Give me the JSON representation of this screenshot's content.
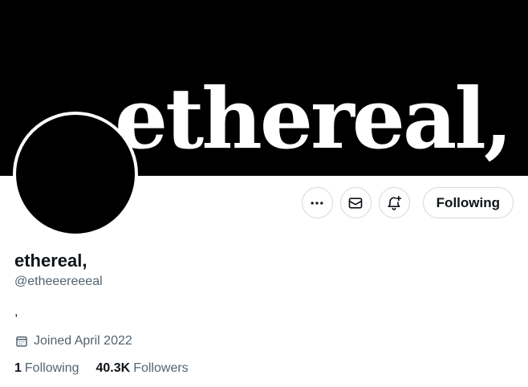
{
  "banner": {
    "text": "ethereal,"
  },
  "actions": {
    "more_icon": "more-horizontal-icon",
    "message_icon": "envelope-icon",
    "notify_icon": "bell-plus-icon",
    "following_label": "Following"
  },
  "profile": {
    "display_name": "ethereal,",
    "handle": "@etheeereeeal",
    "bio": ",",
    "joined": "Joined April 2022"
  },
  "stats": {
    "following_count": "1",
    "following_label": "Following",
    "followers_count": "40.3K",
    "followers_label": "Followers"
  },
  "colors": {
    "primary_text": "#0f1419",
    "secondary_text": "#536471",
    "border": "#cfd9de",
    "banner_bg": "#000000"
  }
}
